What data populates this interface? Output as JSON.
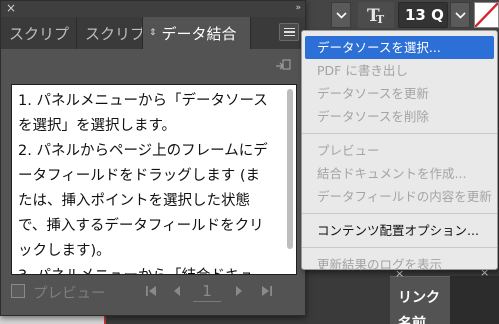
{
  "toolbar": {
    "font_size_value": "13 Q",
    "type_icon": "text-type-icon",
    "chevron_icon": "chevron-down-icon"
  },
  "panel": {
    "close_glyph": "×",
    "collapse_glyph": "»",
    "tabs": [
      {
        "label": "スクリプ"
      },
      {
        "label": "スクリプ"
      },
      {
        "label": "データ結合",
        "sort_glyph": "⇕"
      }
    ],
    "menu_icon": "hamburger-menu-icon",
    "link_icon": "update-link-icon",
    "help_text": "1. パネルメニューから「データソースを選択」を選択します。\n2. パネルからページ上のフレームにデータフィールドをドラッグします (または、挿入ポイントを選択した状態で、挿入するデータフィールドをクリックします)。\n3. パネルメニューから「結合ドキュ",
    "preview_label": "プレビュー",
    "page_number": "1"
  },
  "context_menu": {
    "items": [
      {
        "label": "データソースを選択...",
        "state": "selected"
      },
      {
        "label": "PDF に書き出し",
        "state": "disabled"
      },
      {
        "label": "データソースを更新",
        "state": "disabled"
      },
      {
        "label": "データソースを削除",
        "state": "disabled"
      },
      {
        "separator": true
      },
      {
        "label": "プレビュー",
        "state": "disabled"
      },
      {
        "label": "結合ドキュメントを作成...",
        "state": "disabled"
      },
      {
        "label": "データフィールドの内容を更新",
        "state": "disabled"
      },
      {
        "separator": true
      },
      {
        "label": "コンテンツ配置オプション...",
        "state": "enabled"
      },
      {
        "separator": true
      },
      {
        "label": "更新結果のログを表示",
        "state": "disabled"
      }
    ]
  },
  "background_panel": {
    "close_glyph": "×",
    "tab_label": "リンク",
    "tab_label_2": "名前"
  },
  "colors": {
    "panel_bg": "#535353",
    "tab_bar_bg": "#3a3a3a",
    "menu_bg": "#e9e9e9",
    "menu_highlight": "#2c6fd6",
    "disabled_text": "#a4a4a4"
  }
}
